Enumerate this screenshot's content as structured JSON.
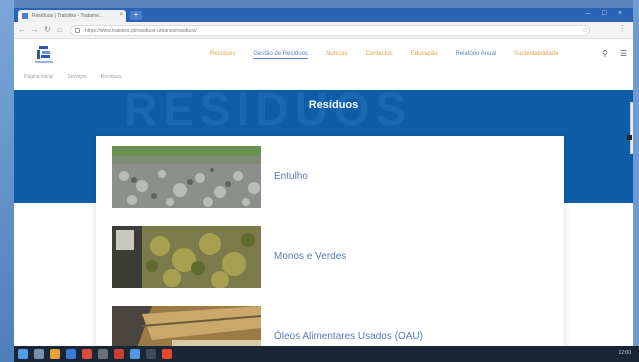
{
  "browser": {
    "tab_title": "Resíduos | Tratolixo - Tratame...",
    "tab_close": "×",
    "new_tab": "+",
    "url": "https://www.tratolixo.pt/residuos-urbanos/residuos/",
    "window_controls": [
      "–",
      "□",
      "×"
    ]
  },
  "site": {
    "nav": [
      {
        "label": "Resíduos",
        "state": "normal"
      },
      {
        "label": "Gestão de Resíduos",
        "state": "active"
      },
      {
        "label": "Notícias",
        "state": "normal"
      },
      {
        "label": "Contactos",
        "state": "normal"
      },
      {
        "label": "Educação",
        "state": "normal"
      },
      {
        "label": "Relatório Anual",
        "state": "blue"
      },
      {
        "label": "Sustentabilidade",
        "state": "normal"
      }
    ],
    "search_icon": "🔍",
    "menu_icon": "☰"
  },
  "breadcrumb": [
    "Página inicial",
    "Serviços",
    "Resíduos"
  ],
  "hero": {
    "ghost_text": "RESÍDUOS",
    "title": "Resíduos"
  },
  "items": [
    {
      "label": "Entulho",
      "icon": "rubble-photo"
    },
    {
      "label": "Monos e Verdes",
      "icon": "green-waste-photo"
    },
    {
      "label": "Óleos Alimentares Usados (OAU)",
      "icon": "used-oil-photo"
    }
  ],
  "taskbar": {
    "clock": "12:00"
  },
  "colors": {
    "brand_blue": "#0f5ca7",
    "nav_orange": "#e0a24a",
    "link_blue": "#4f7fb6"
  }
}
